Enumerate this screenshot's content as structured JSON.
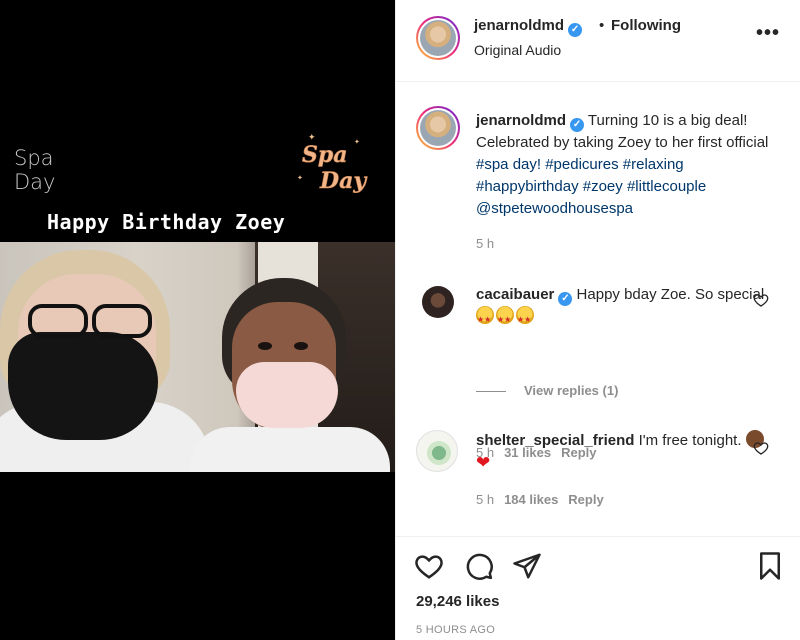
{
  "media": {
    "sticker_left": "Spa\nDay",
    "sticker_right": "Spa Day",
    "caption": "Happy Birthday Zoey"
  },
  "header": {
    "username": "jenarnoldmd",
    "dot": "•",
    "follow_label": "Following",
    "subtitle": "Original Audio",
    "more_icon": "more-horizontal-icon"
  },
  "post": {
    "username": "jenarnoldmd",
    "text": " Turning 10 is a big deal! Celebrated by taking Zoey to her first official ",
    "tags": [
      "#spa day!",
      "#pedicures",
      "#relaxing",
      "#happybirthday",
      "#zoey",
      "#littlecouple",
      "@stpetewoodhousespa"
    ],
    "time": "5 h"
  },
  "comments": [
    {
      "username": "cacaibauer",
      "verified": true,
      "text": " Happy bday Zoe. So special ",
      "emojis": [
        "star-struck",
        "star-struck",
        "star-struck"
      ],
      "time": "5 h",
      "likes": "31 likes",
      "reply": "Reply"
    },
    {
      "username": "shelter_special_friend",
      "verified": false,
      "text": " I'm free tonight. ",
      "emojis": [
        "person-gesturing",
        "red-heart"
      ],
      "time": "5 h",
      "likes": "184 likes",
      "reply": "Reply"
    }
  ],
  "view_replies": "View replies (1)",
  "footer": {
    "likes": "29,246 likes",
    "ago": "5 HOURS AGO"
  },
  "colors": {
    "verified": "#3897f0",
    "link": "#00376b",
    "muted": "#8e8e8e",
    "heart": "#e0171f"
  }
}
